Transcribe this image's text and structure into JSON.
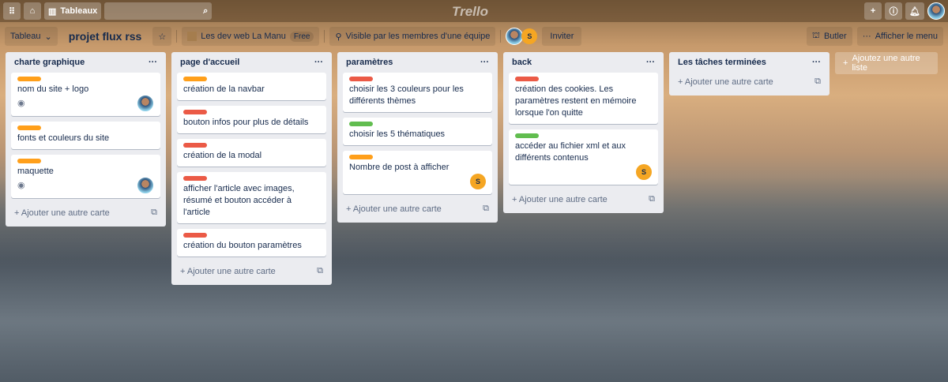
{
  "topbar": {
    "boards_label": "Tableaux",
    "logo": "Trello",
    "search_placeholder": ""
  },
  "board": {
    "view_label": "Tableau",
    "title": "projet flux rss",
    "team": "Les dev web La Manu",
    "team_badge": "Free",
    "visibility": "Visible par les membres d'une équipe",
    "member_initial": "S",
    "invite": "Inviter",
    "butler": "Butler",
    "menu": "Afficher le menu"
  },
  "colors": {
    "orange": "#ff9f1a",
    "red": "#eb5a46",
    "green": "#61bd4f"
  },
  "add_card": "Ajouter une autre carte",
  "add_list": "Ajoutez une autre liste",
  "lists": [
    {
      "title": "charte graphique",
      "cards": [
        {
          "label": "orange",
          "text": "nom du site + logo",
          "watch": true,
          "member": "avatar"
        },
        {
          "label": "orange",
          "text": "fonts et couleurs du site"
        },
        {
          "label": "orange",
          "text": "maquette",
          "watch": true,
          "member": "avatar"
        }
      ]
    },
    {
      "title": "page d'accueil",
      "cards": [
        {
          "label": "orange",
          "text": "création de la navbar"
        },
        {
          "label": "red",
          "text": "bouton infos pour plus de détails"
        },
        {
          "label": "red",
          "text": "création de la modal"
        },
        {
          "label": "red",
          "text": "afficher l'article avec images, résumé et bouton accéder à l'article"
        },
        {
          "label": "red",
          "text": "création du bouton paramètres"
        }
      ]
    },
    {
      "title": "paramètres",
      "cards": [
        {
          "label": "red",
          "text": "choisir les 3 couleurs pour les différents thèmes"
        },
        {
          "label": "green",
          "text": "choisir les 5 thématiques"
        },
        {
          "label": "orange",
          "text": "Nombre de post à afficher",
          "member": "S"
        }
      ]
    },
    {
      "title": "back",
      "cards": [
        {
          "label": "red",
          "text": "création des cookies. Les paramètres restent en mémoire lorsque l'on quitte"
        },
        {
          "label": "green",
          "text": "accéder au fichier xml et aux différents contenus",
          "member": "S"
        }
      ]
    },
    {
      "title": "Les tâches terminées",
      "cards": []
    }
  ]
}
